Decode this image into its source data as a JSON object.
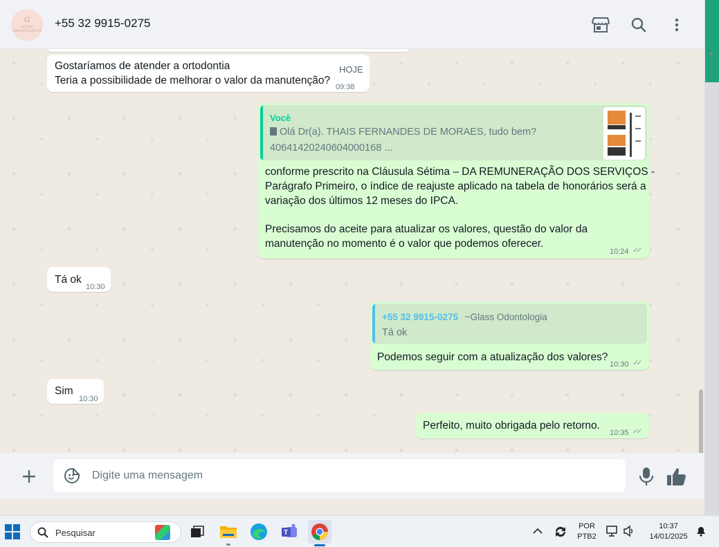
{
  "header": {
    "contact_name": "+55 32 9915-0275",
    "avatar_text": "GLASS ODONTOLOGIA",
    "icons": [
      "store-icon",
      "search-icon",
      "menu-icon"
    ]
  },
  "messages": {
    "m1": {
      "line1": "Gostaríamos de atender a ortodontia",
      "line2": "Teria a possibilidade de melhorar o valor da manutenção?",
      "badge": "HOJE",
      "time": "09:38"
    },
    "m2": {
      "quote_author": "Você",
      "quote_line1": "Olá Dr(a). THAIS FERNANDES DE MORAES, tudo bem?",
      "quote_line2": "40641420240604000168 ...",
      "line1": "conforme prescrito na Cláusula Sétima – DA REMUNERAÇÃO DOS SERVIÇOS -",
      "line2": "Parágrafo Primeiro, o índice de reajuste aplicado na tabela de honorários será a",
      "line3": "variação dos últimos 12 meses do IPCA.",
      "line4": "Precisamos do aceite para atualizar os valores, questão do valor da",
      "line5": "manutenção no momento é o valor que podemos oferecer.",
      "time": "10:24"
    },
    "m3": {
      "text": "Tá ok",
      "time": "10:30"
    },
    "m4": {
      "quote_author": "+55 32 9915-0275",
      "quote_group": "~Glass Odontologia",
      "quote_text": "Tá ok",
      "text": "Podemos seguir com a atualização dos valores?",
      "time": "10:30"
    },
    "m5": {
      "text": "Sim",
      "time": "10:30"
    },
    "m6": {
      "text": "Perfeito, muito obrigada pelo retorno.",
      "time": "10:35"
    }
  },
  "composer": {
    "placeholder": "Digite uma mensagem"
  },
  "taskbar": {
    "search_placeholder": "Pesquisar",
    "lang_line1": "POR",
    "lang_line2": "PTB2",
    "clock_time": "10:37",
    "clock_date": "14/01/2025"
  },
  "colors": {
    "accent_green": "#1fa37a",
    "outgoing_bubble": "#d9fdd3",
    "incoming_bubble": "#ffffff",
    "chat_bg": "#efeae2"
  }
}
